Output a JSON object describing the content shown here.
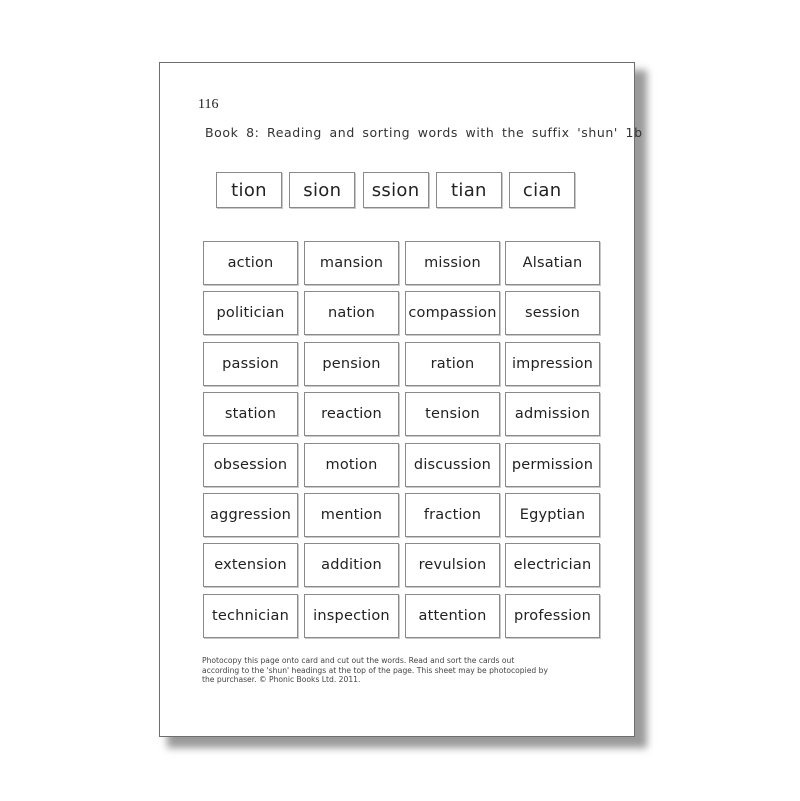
{
  "page": {
    "number": "116",
    "title": "Book 8:  Reading and sorting words with the suffix 'shun' 1b"
  },
  "headings": [
    "tion",
    "sion",
    "ssion",
    "tian",
    "cian"
  ],
  "cards": [
    [
      "action",
      "mansion",
      "mission",
      "Alsatian"
    ],
    [
      "politician",
      "nation",
      "compassion",
      "session"
    ],
    [
      "passion",
      "pension",
      "ration",
      "impression"
    ],
    [
      "station",
      "reaction",
      "tension",
      "admission"
    ],
    [
      "obsession",
      "motion",
      "discussion",
      "permission"
    ],
    [
      "aggression",
      "mention",
      "fraction",
      "Egyptian"
    ],
    [
      "extension",
      "addition",
      "revulsion",
      "electrician"
    ],
    [
      "technician",
      "inspection",
      "attention",
      "profession"
    ]
  ],
  "footer": {
    "line1": "Photocopy this page onto card and cut out the words.  Read and sort the cards out",
    "line2": "according to the 'shun' headings at the top of the page.  This sheet may be photocopied by",
    "line3": "the purchaser.  © Phonic Books Ltd. 2011."
  }
}
